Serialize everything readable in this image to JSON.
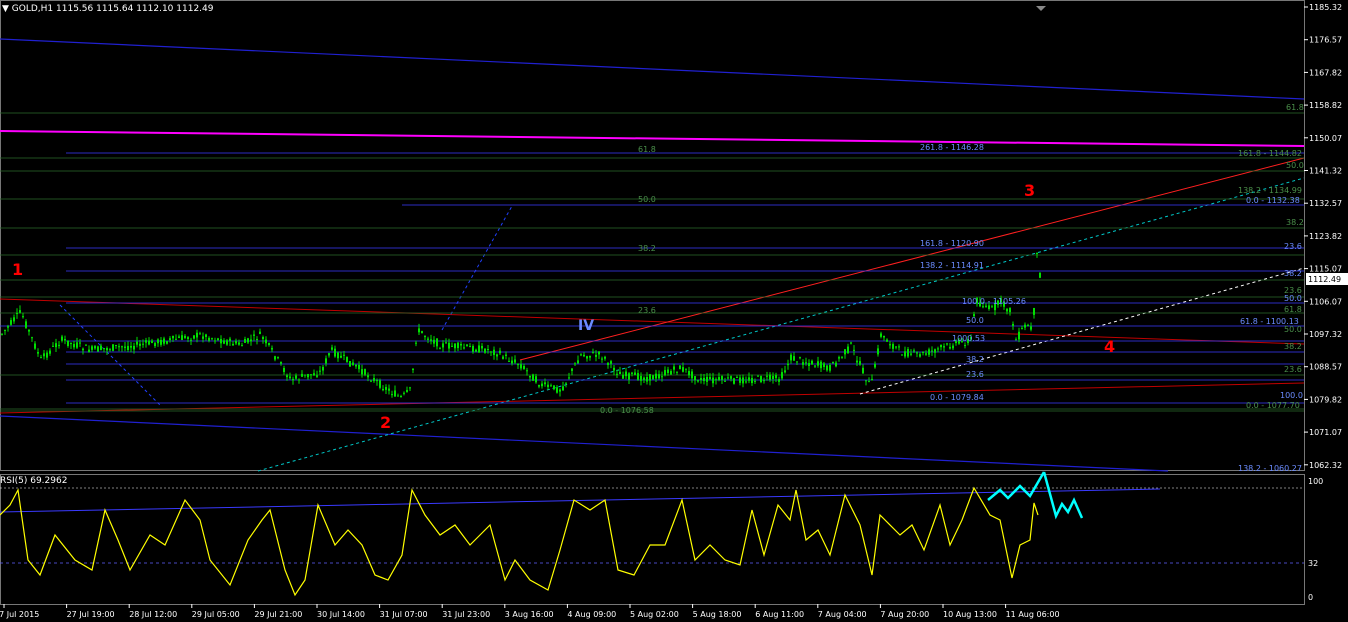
{
  "header": {
    "symbol": "GOLD,H1",
    "ohlc": "1115.56 1115.64 1112.10 1112.49"
  },
  "price_axis": {
    "ticks": [
      "1185.32",
      "1176.57",
      "1167.82",
      "1158.82",
      "1150.07",
      "1141.32",
      "1132.57",
      "1123.82",
      "1115.07",
      "1106.07",
      "1097.32",
      "1088.57",
      "1079.82",
      "1071.07",
      "1062.32"
    ],
    "current_price": "1112.49"
  },
  "rsi": {
    "title": "RSI(5) 69.2962",
    "levels": [
      "100",
      "32",
      "0"
    ]
  },
  "time_axis": {
    "labels": [
      "27 Jul 2015",
      "27 Jul 19:00",
      "28 Jul 12:00",
      "29 Jul 05:00",
      "29 Jul 21:00",
      "30 Jul 14:00",
      "31 Jul 07:00",
      "31 Jul 23:00",
      "3 Aug 16:00",
      "4 Aug 09:00",
      "5 Aug 02:00",
      "5 Aug 18:00",
      "6 Aug 11:00",
      "7 Aug 04:00",
      "7 Aug 20:00",
      "10 Aug 13:00",
      "11 Aug 06:00"
    ]
  },
  "wave_labels": [
    {
      "text": "1",
      "color": "#ff0000"
    },
    {
      "text": "2",
      "color": "#ff0000"
    },
    {
      "text": "3",
      "color": "#ff0000"
    },
    {
      "text": "4",
      "color": "#ff0000"
    },
    {
      "text": "IV",
      "color": "#6b8cff"
    }
  ],
  "fib_labels": [
    {
      "text": "261.8 - 1146.28",
      "color": "#6b8cff"
    },
    {
      "text": "161.8 - 1120.90",
      "color": "#6b8cff"
    },
    {
      "text": "138.2 - 1114.91",
      "color": "#6b8cff"
    },
    {
      "text": "100.0 - 1105.26",
      "color": "#6b8cff"
    },
    {
      "text": "0.0 - 1079.84",
      "color": "#6b8cff"
    },
    {
      "text": "61.8",
      "color": "#4a8f4a"
    },
    {
      "text": "50.0",
      "color": "#4a8f4a"
    },
    {
      "text": "38.2",
      "color": "#4a8f4a"
    },
    {
      "text": "23.6",
      "color": "#4a8f4a"
    },
    {
      "text": "0.0 - 1076.58",
      "color": "#4a8f4a"
    },
    {
      "text": "50.0",
      "color": "#6b8cff"
    },
    {
      "text": "38.2",
      "color": "#6b8cff"
    },
    {
      "text": "23.6",
      "color": "#6b8cff"
    },
    {
      "text": "61.8",
      "color": "#4a8f4a"
    },
    {
      "text": "50.0",
      "color": "#4a8f4a"
    },
    {
      "text": "161.8 - 1144.82",
      "color": "#4a8f4a"
    },
    {
      "text": "138.2 - 1134.99",
      "color": "#4a8f4a"
    },
    {
      "text": "0.0 - 1132.38",
      "color": "#6b8cff"
    },
    {
      "text": "38.2",
      "color": "#4a8f4a"
    },
    {
      "text": "23.6",
      "color": "#6b8cff"
    },
    {
      "text": "38.2",
      "color": "#6b8cff"
    },
    {
      "text": "23.6",
      "color": "#4a8f4a"
    },
    {
      "text": "50.0",
      "color": "#6b8cff"
    },
    {
      "text": "61.8",
      "color": "#4a8f4a"
    },
    {
      "text": "61.8 - 1100.13",
      "color": "#6b8cff"
    },
    {
      "text": "50.0",
      "color": "#4a8f4a"
    },
    {
      "text": "38.2",
      "color": "#4a8f4a"
    },
    {
      "text": "23.6",
      "color": "#4a8f4a"
    },
    {
      "text": "100.0",
      "color": "#6b8cff"
    },
    {
      "text": "0.0 - 1077.70",
      "color": "#4a8f4a"
    },
    {
      "text": "138.2 - 1060.27",
      "color": "#6b8cff"
    },
    {
      "text": "1000.53",
      "color": "#6b8cff"
    }
  ],
  "colors": {
    "background": "#000000",
    "candle": "#00e000",
    "rsi_line": "#ffff00",
    "magenta": "#ff00ff",
    "red_channel": "#ff0000",
    "blue_channel": "#1f1fcf",
    "cyan_dotted": "#00c8c8",
    "fib_blue": "#3a3aff",
    "fib_green": "#2a5a2a",
    "arrow": "#00ffff"
  }
}
